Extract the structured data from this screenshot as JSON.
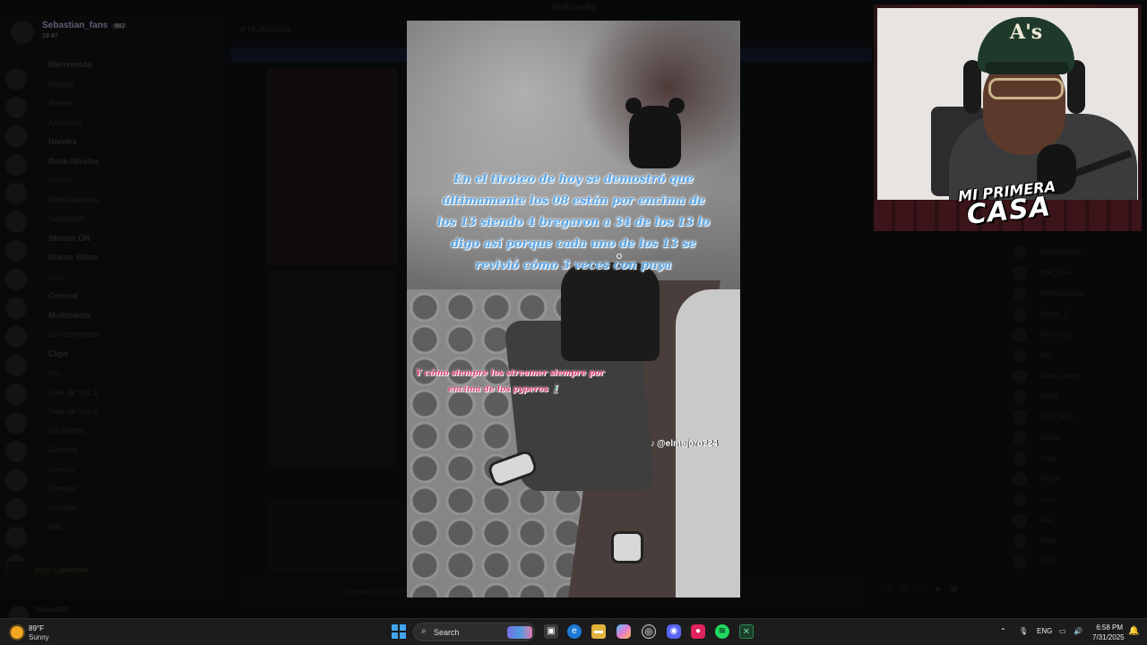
{
  "window": {
    "title": "Multimedia"
  },
  "server": {
    "name": "Sebastian_fans",
    "badge": "IMJ",
    "time": "18:47"
  },
  "channels": [
    {
      "label": "Bienvenida",
      "kind": "bold"
    },
    {
      "label": "Reglas",
      "kind": "normal"
    },
    {
      "label": "Avisos",
      "kind": "normal"
    },
    {
      "label": "Anuncios",
      "kind": "normal"
    },
    {
      "label": "Niveles",
      "kind": "bold"
    },
    {
      "label": "Rank-Niveles",
      "kind": "bold"
    },
    {
      "label": "Stream",
      "kind": "cat"
    },
    {
      "label": "Notificaciones",
      "kind": "normal"
    },
    {
      "label": "Sebastian",
      "kind": "normal"
    },
    {
      "label": "Stream ON",
      "kind": "bold"
    },
    {
      "label": "Nuevo Video",
      "kind": "bold"
    },
    {
      "label": "Chat",
      "kind": "cat"
    },
    {
      "label": "General",
      "kind": "bold"
    },
    {
      "label": "Multimedia",
      "kind": "bold"
    },
    {
      "label": "Bot-comandos",
      "kind": "normal"
    },
    {
      "label": "Clips",
      "kind": "bold"
    },
    {
      "label": "Voz",
      "kind": "cat"
    },
    {
      "label": "Sala de Voz 1",
      "kind": "normal"
    },
    {
      "label": "Sala de Voz 2",
      "kind": "normal"
    },
    {
      "label": "En directo",
      "kind": "normal"
    },
    {
      "label": "Gaming",
      "kind": "normal"
    },
    {
      "label": "Eventos",
      "kind": "cat"
    },
    {
      "label": "Torneos",
      "kind": "normal"
    },
    {
      "label": "Sorteos",
      "kind": "normal"
    },
    {
      "label": "Info",
      "kind": "normal"
    }
  ],
  "voice": {
    "status": "Voice Connected"
  },
  "user": {
    "name": "Nodos992"
  },
  "chat": {
    "channel": "Multimedia",
    "banner": "",
    "input_placeholder": "Message #Multimedia"
  },
  "members": [
    "Moderadores",
    "Mod_User",
    "Administrador",
    "Admin_2",
    "Miembros",
    "Niki",
    "Black_water",
    "Nuvia",
    "Dark_Rine",
    "Sebas",
    "Hugo",
    "Flame",
    "Luna",
    "Kira",
    "Nexo",
    "Pollo"
  ],
  "video": {
    "caption_main": "En el tiroteo de hoy se demostró que últimamente los 08 están por encima de los 13 siendo 4 bregaron a 34 de los 13 lo digo así porque cada uno de los 13 se revivió cómo 3 veces con puya",
    "caption_sub_line1": "Y cómo siempre los streamer siempre por",
    "caption_sub_line2": "encima de los pyperos 🚶🏻‍♂️",
    "watermark": "@elmejoro224"
  },
  "webcam": {
    "cap_logo": "A's",
    "overlay_line1": "MI PRIMERA",
    "overlay_line2": "CASA"
  },
  "taskbar": {
    "weather_temp": "89°F",
    "weather_cond": "Sunny",
    "search_label": "Search",
    "lang": "ENG",
    "time": "6:58 PM",
    "date": "7/31/2025"
  }
}
